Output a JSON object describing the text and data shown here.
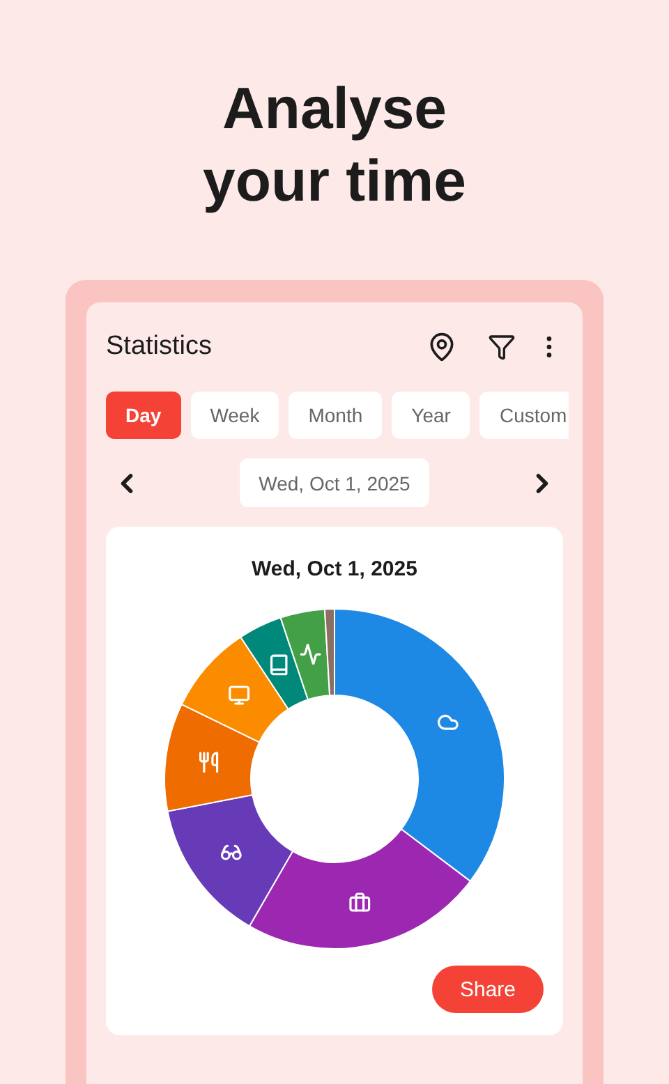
{
  "headline": "Analyse your time",
  "app": {
    "title": "Statistics",
    "periods": [
      {
        "label": "Day",
        "selected": true
      },
      {
        "label": "Week",
        "selected": false
      },
      {
        "label": "Month",
        "selected": false
      },
      {
        "label": "Year",
        "selected": false
      },
      {
        "label": "Custom",
        "selected": false
      }
    ],
    "date": "Wed, Oct 1, 2025",
    "chart_title": "Wed, Oct 1, 2025",
    "share": "Share"
  }
}
